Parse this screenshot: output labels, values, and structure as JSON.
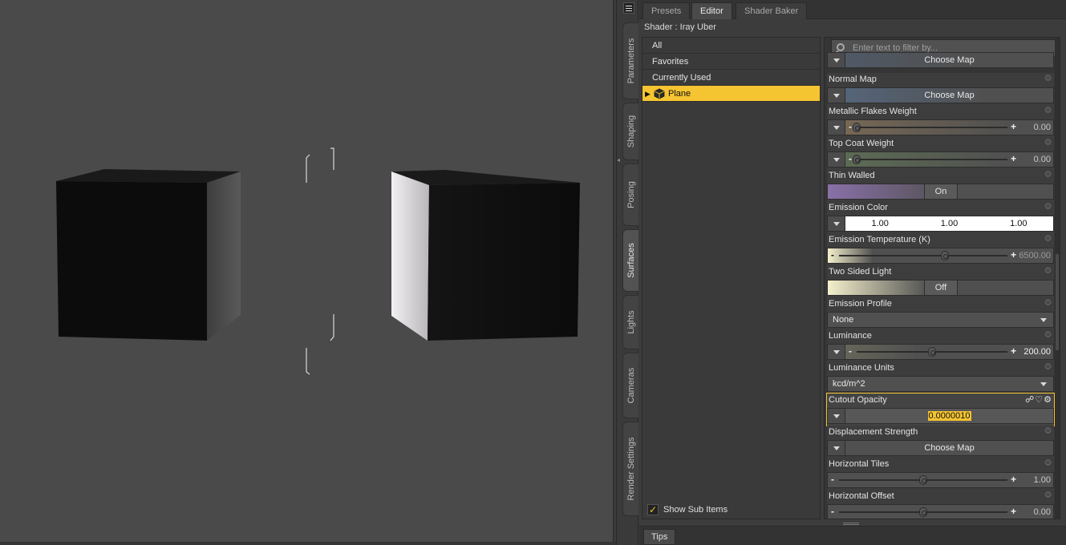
{
  "side_tabs": [
    "Parameters",
    "Shaping",
    "Posing",
    "Surfaces",
    "Lights",
    "Cameras",
    "Render Settings"
  ],
  "top_tabs": [
    "Presets",
    "Editor",
    "Shader Baker"
  ],
  "shader_label": "Shader : Iray Uber",
  "tree": {
    "items": [
      "All",
      "Favorites",
      "Currently Used"
    ],
    "selected_item": "Plane",
    "show_sub_items": "Show Sub Items",
    "show_sub_checked": true
  },
  "filter": {
    "placeholder": "Enter text to filter by..."
  },
  "props": {
    "partial_map_label": "Choose Map",
    "normal_map": {
      "label": "Normal Map",
      "button": "Choose Map"
    },
    "metallic_flakes": {
      "label": "Metallic Flakes Weight",
      "value": "0.00",
      "fraction": 0.0
    },
    "top_coat": {
      "label": "Top Coat Weight",
      "value": "0.00",
      "fraction": 0.0
    },
    "thin_walled": {
      "label": "Thin Walled",
      "value": "On"
    },
    "emission_color": {
      "label": "Emission Color",
      "r": "1.00",
      "g": "1.00",
      "b": "1.00"
    },
    "emission_temp": {
      "label": "Emission Temperature (K)",
      "value": "6500.00",
      "fraction": 0.63
    },
    "two_sided": {
      "label": "Two Sided Light",
      "value": "Off"
    },
    "emission_profile": {
      "label": "Emission Profile",
      "value": "None"
    },
    "luminance": {
      "label": "Luminance",
      "value": "200.00",
      "fraction": 0.5
    },
    "luminance_units": {
      "label": "Luminance Units",
      "value": "kcd/m^2"
    },
    "cutout_opacity": {
      "label": "Cutout Opacity",
      "value": "0.0000010"
    },
    "displacement": {
      "label": "Displacement Strength",
      "button": "Choose Map"
    },
    "h_tiles": {
      "label": "Horizontal Tiles",
      "value": "1.00",
      "fraction": 0.5
    },
    "h_offset": {
      "label": "Horizontal Offset",
      "value": "0.00",
      "fraction": 0.5
    }
  },
  "bottom_tab": "Tips",
  "colors": {
    "selection": "#f5c431",
    "metallic_tint": "#7a6a55",
    "top_coat_tint": "#5e6e55",
    "map_tint": "#55677e",
    "thin_walled_tint": "#8a70a8",
    "viewport_bg": "#4a4a4a"
  }
}
